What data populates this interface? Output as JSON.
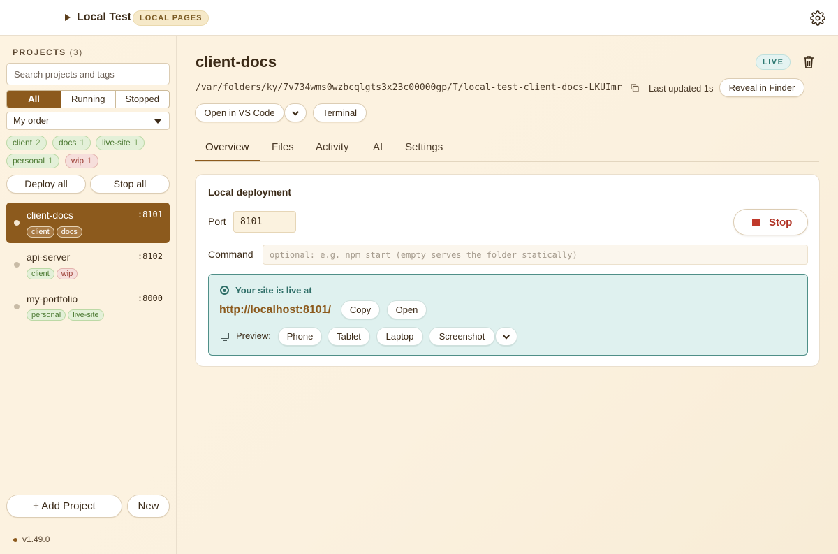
{
  "app": {
    "title": "Local Test",
    "badge": "LOCAL PAGES"
  },
  "sidebar": {
    "projects_heading": "PROJECTS",
    "projects_count": "(3)",
    "search_placeholder": "Search projects and tags",
    "filters": [
      "All",
      "Running",
      "Stopped"
    ],
    "sort_value": "My order",
    "tags": [
      {
        "label": "client",
        "count": "2",
        "color": "green"
      },
      {
        "label": "docs",
        "count": "1",
        "color": "green"
      },
      {
        "label": "live-site",
        "count": "1",
        "color": "green"
      },
      {
        "label": "personal",
        "count": "1",
        "color": "green"
      },
      {
        "label": "wip",
        "count": "1",
        "color": "red"
      }
    ],
    "deploy_all": "Deploy all",
    "stop_all": "Stop all",
    "projects": [
      {
        "name": "client-docs",
        "port": ":8101",
        "tags": [
          "client",
          "docs"
        ],
        "active": true
      },
      {
        "name": "api-server",
        "port": ":8102",
        "tags": [
          "client",
          "wip"
        ],
        "active": false
      },
      {
        "name": "my-portfolio",
        "port": ":8000",
        "tags": [
          "personal",
          "live-site"
        ],
        "active": false
      }
    ],
    "add_project": "+ Add Project",
    "new": "New",
    "version": "v1.49.0"
  },
  "main": {
    "title": "client-docs",
    "status_badge": "LIVE",
    "path": "/var/folders/ky/7v734wms0wzbcqlgts3x23c00000gp/T/local-test-client-docs-LKUImr",
    "last_updated": "Last updated 1s",
    "reveal": "Reveal in Finder",
    "open_vscode": "Open in VS Code",
    "terminal": "Terminal",
    "tabs": [
      "Overview",
      "Files",
      "Activity",
      "AI",
      "Settings"
    ],
    "card": {
      "title": "Local deployment",
      "port_label": "Port",
      "port_value": "8101",
      "stop": "Stop",
      "command_label": "Command",
      "command_placeholder": "optional: e.g. npm start (empty serves the folder statically)",
      "live_label": "Your site is live at",
      "url": "http://localhost:8101/",
      "copy": "Copy",
      "open": "Open",
      "preview_label": "Preview:",
      "preview_options": [
        "Phone",
        "Tablet",
        "Laptop",
        "Screenshot"
      ]
    }
  },
  "colors": {
    "accent": "#8c5a1d",
    "live": "#2f7a72",
    "stop": "#c0392b"
  }
}
